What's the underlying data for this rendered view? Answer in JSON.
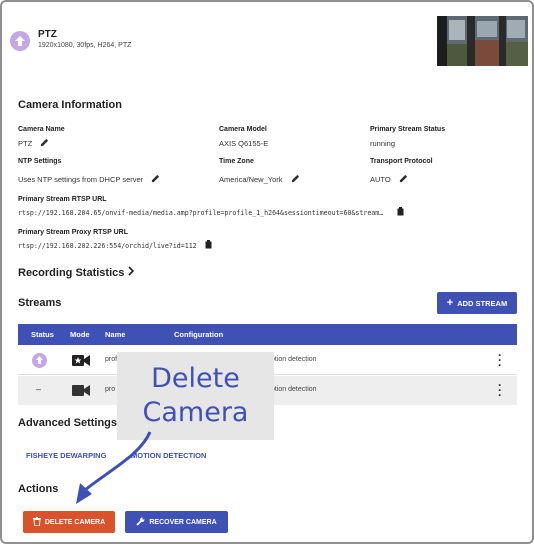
{
  "header": {
    "title": "PTZ",
    "subtitle": "1920x1080, 30fps, H264, PTZ"
  },
  "camera_info": {
    "section_title": "Camera Information",
    "camera_name_label": "Camera Name",
    "camera_name_value": "PTZ",
    "camera_model_label": "Camera Model",
    "camera_model_value": "AXIS Q6155-E",
    "stream_status_label": "Primary Stream Status",
    "stream_status_value": "running",
    "ntp_label": "NTP Settings",
    "ntp_value": "Uses NTP settings from DHCP server",
    "timezone_label": "Time Zone",
    "timezone_value": "America/New_York",
    "transport_label": "Transport Protocol",
    "transport_value": "AUTO",
    "rtsp_label": "Primary Stream RTSP URL",
    "rtsp_value": "rtsp://192.168.204.65/onvif-media/media.amp?profile=profile_1_h264&sessiontimeout=60&stream…",
    "proxy_label": "Primary Stream Proxy RTSP URL",
    "proxy_value": "rtsp://192.168.202.226:554/orchid/live?id=112"
  },
  "recording": {
    "title": "Recording Statistics"
  },
  "streams": {
    "title": "Streams",
    "add_label": "ADD STREAM",
    "columns": [
      "Status",
      "Mode",
      "Name",
      "Configuration"
    ],
    "rows": [
      {
        "status": "up-arrow-circle",
        "mode": "video-camera-active",
        "name": "prof",
        "configuration": "otion detection"
      },
      {
        "status": "–",
        "mode": "video-camera",
        "name": "pro",
        "configuration": "otion detection"
      }
    ]
  },
  "advanced": {
    "title": "Advanced Settings",
    "fisheye_label": "FISHEYE DEWARPING",
    "motion_label": "MOTION DETECTION"
  },
  "actions": {
    "title": "Actions",
    "delete_label": "DELETE CAMERA",
    "recover_label": "RECOVER CAMERA"
  },
  "callout": {
    "line1": "Delete",
    "line2": "Camera"
  },
  "colors": {
    "primary": "#3f51b5",
    "danger": "#d9522b",
    "status_icon": "#c4a8e6"
  }
}
